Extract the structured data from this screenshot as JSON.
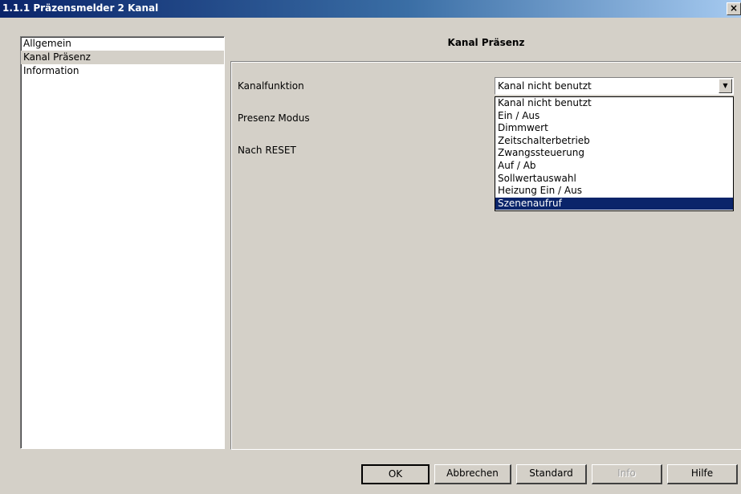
{
  "window": {
    "title": "1.1.1 Präzensmelder 2 Kanal",
    "close_symbol": "×"
  },
  "sidebar": {
    "items": [
      {
        "label": "Allgemein"
      },
      {
        "label": "Kanal Präsenz",
        "selected": true
      },
      {
        "label": "Information"
      }
    ]
  },
  "main": {
    "section_title": "Kanal Präsenz",
    "fields": [
      {
        "label": "Kanalfunktion"
      },
      {
        "label": "Presenz Modus"
      },
      {
        "label": "Nach RESET"
      }
    ],
    "combo": {
      "value": "Kanal nicht benutzt",
      "arrow_icon": "chevron-down-icon",
      "options": [
        "Kanal nicht benutzt",
        "Ein / Aus",
        "Dimmwert",
        "Zeitschalterbetrieb",
        "Zwangssteuerung",
        "Auf / Ab",
        "Sollwertauswahl",
        "Heizung Ein / Aus",
        "Szenenaufruf"
      ],
      "highlighted_option": "Szenenaufruf"
    }
  },
  "buttons": {
    "ok": "OK",
    "cancel": "Abbrechen",
    "standard": "Standard",
    "info": "Info",
    "help": "Hilfe"
  },
  "colors": {
    "title_gradient_start": "#0a246a",
    "title_gradient_end": "#a6caf0",
    "selection_highlight": "#0a246a",
    "dialog_background": "#d4d0c8"
  }
}
